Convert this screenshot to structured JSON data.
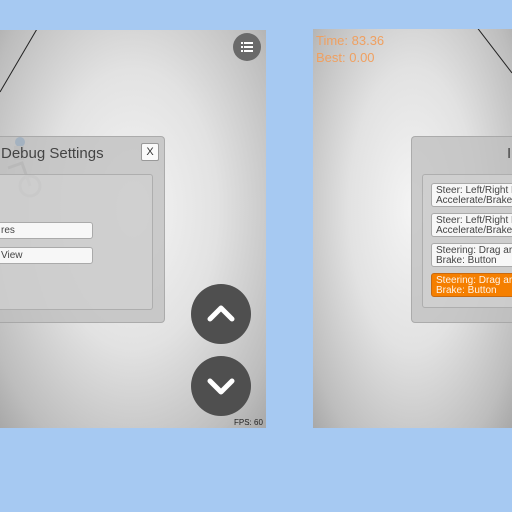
{
  "left_screen": {
    "debug_panel": {
      "title": "Debug Settings",
      "close_label": "X",
      "options": [
        {
          "label": "res"
        },
        {
          "label": "View"
        }
      ]
    },
    "fps_text": "FPS: 60",
    "menu_icon": "list-icon",
    "controls": {
      "up_icon": "chevron-up-icon",
      "down_icon": "chevron-down-icon"
    }
  },
  "right_screen": {
    "hud": {
      "time_text": "Time: 83.36",
      "best_text": "Best: 0.00"
    },
    "panel": {
      "title": "I",
      "options": [
        {
          "line1": "Steer: Left/Right D",
          "line2": "Accelerate/Brake:",
          "selected": false
        },
        {
          "line1": "Steer: Left/Right D",
          "line2": "Accelerate/Brake:",
          "selected": false
        },
        {
          "line1": "Steering: Drag aro",
          "line2": "Brake: Button",
          "selected": false
        },
        {
          "line1": "Steering: Drag aro",
          "line2": "Brake: Button",
          "selected": true
        }
      ]
    }
  },
  "colors": {
    "background": "#a6c9f2",
    "accent_orange": "#f57f00",
    "hud_text": "#f0a060",
    "control_button": "#4f4f4f"
  }
}
